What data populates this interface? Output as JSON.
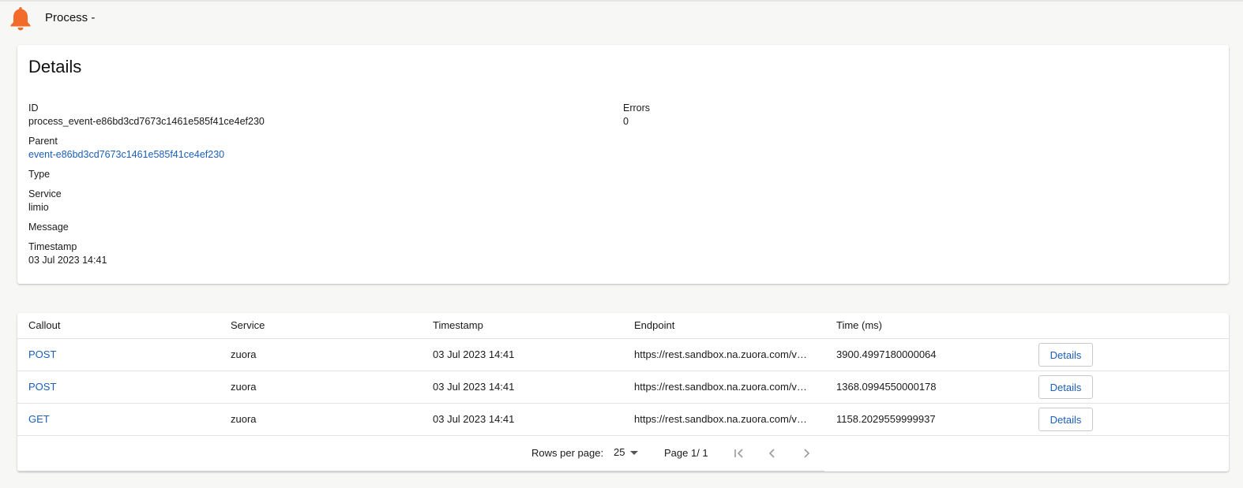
{
  "colors": {
    "accent": "#f26b2b",
    "link": "#1b5fb8"
  },
  "header": {
    "icon": "bell-icon",
    "title": "Process -"
  },
  "details": {
    "title": "Details",
    "id": {
      "label": "ID",
      "value": "process_event-e86bd3cd7673c1461e585f41ce4ef230"
    },
    "parent": {
      "label": "Parent",
      "value": "event-e86bd3cd7673c1461e585f41ce4ef230"
    },
    "type": {
      "label": "Type",
      "value": ""
    },
    "service": {
      "label": "Service",
      "value": "limio"
    },
    "message": {
      "label": "Message",
      "value": ""
    },
    "timestamp": {
      "label": "Timestamp",
      "value": "03 Jul 2023 14:41"
    },
    "errors": {
      "label": "Errors",
      "value": "0"
    }
  },
  "table": {
    "columns": [
      "Callout",
      "Service",
      "Timestamp",
      "Endpoint",
      "Time (ms)"
    ],
    "rows": [
      {
        "callout": "POST",
        "service": "zuora",
        "timestamp": "03 Jul 2023 14:41",
        "endpoint": "https://rest.sandbox.na.zuora.com/v…",
        "time": "3900.4997180000064",
        "action": "Details"
      },
      {
        "callout": "POST",
        "service": "zuora",
        "timestamp": "03 Jul 2023 14:41",
        "endpoint": "https://rest.sandbox.na.zuora.com/v…",
        "time": "1368.0994550000178",
        "action": "Details"
      },
      {
        "callout": "GET",
        "service": "zuora",
        "timestamp": "03 Jul 2023 14:41",
        "endpoint": "https://rest.sandbox.na.zuora.com/v…",
        "time": "1158.2029559999937",
        "action": "Details"
      }
    ]
  },
  "pagination": {
    "rows_per_page_label": "Rows per page:",
    "rows_per_page_value": "25",
    "page_info": "Page 1/ 1",
    "icons": [
      "first-page-icon",
      "previous-page-icon",
      "next-page-icon"
    ]
  }
}
